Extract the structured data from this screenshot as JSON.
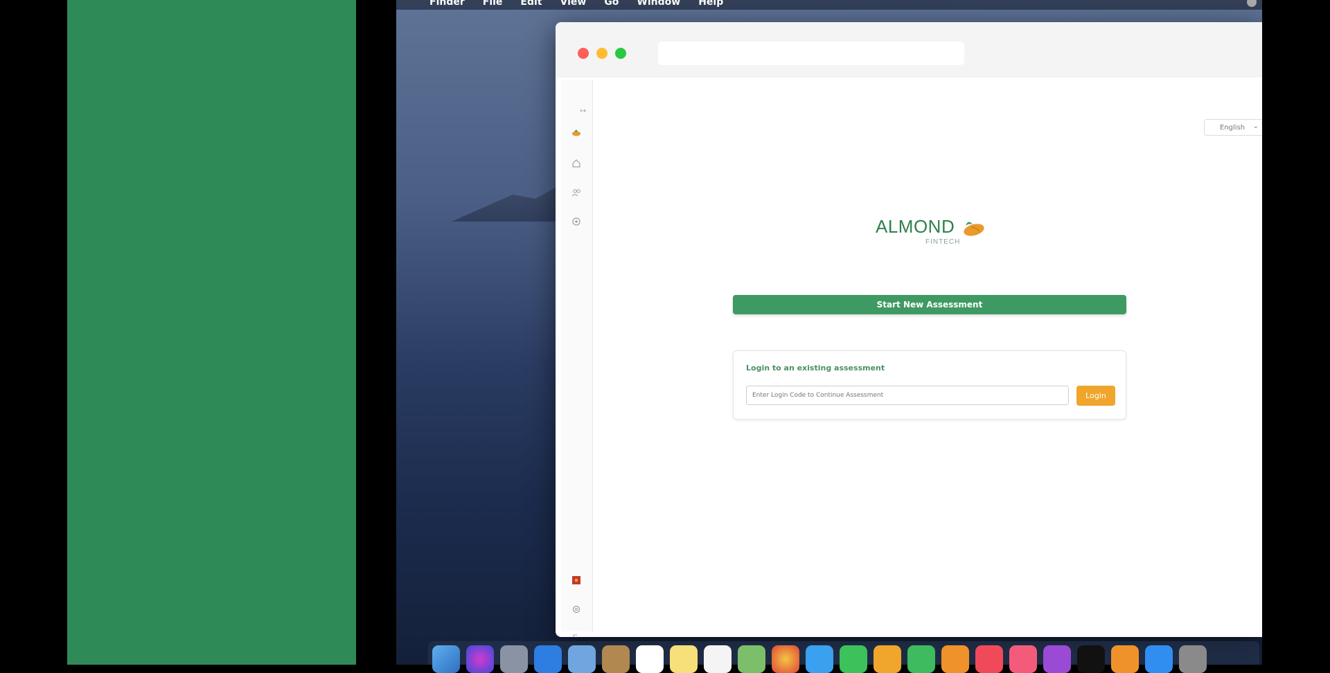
{
  "menubar": {
    "apple": "",
    "items": [
      "Finder",
      "File",
      "Edit",
      "View",
      "Go",
      "Window",
      "Help"
    ]
  },
  "app": {
    "language": "English",
    "logo_word": "ALMOND",
    "logo_sub": "FINTECH",
    "start_button": "Start New Assessment",
    "login_title": "Login to an existing assessment",
    "login_placeholder": "Enter Login Code to Continue Assessment",
    "login_button": "Login",
    "sidebar_icons": [
      "collapse-icon",
      "logo-icon",
      "home-icon",
      "users-icon",
      "settings-gear-icon",
      "flag-icon",
      "cog-icon",
      "logout-icon"
    ]
  },
  "dock": {
    "icons": [
      "finder",
      "siri",
      "launchpad",
      "safari",
      "preview",
      "contacts",
      "calendar",
      "notes",
      "reminders",
      "maps",
      "photos",
      "messages",
      "facetime",
      "keynote",
      "numbers",
      "pages",
      "news",
      "music",
      "podcasts",
      "tv",
      "books",
      "app-store",
      "system-preferences"
    ]
  },
  "colors": {
    "brand_green": "#3e9a62",
    "accent_orange": "#f0a52c",
    "panel_green": "#2e8b57"
  }
}
